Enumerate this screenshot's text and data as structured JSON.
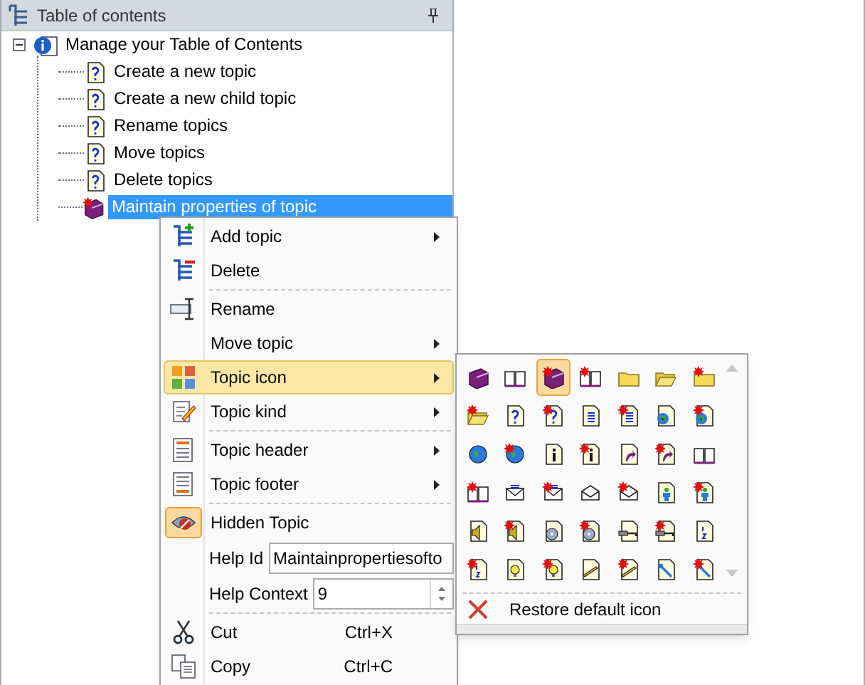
{
  "panel": {
    "title": "Table of contents"
  },
  "tree": [
    {
      "label": "Manage your Table of Contents",
      "kind": "info",
      "expanded": true,
      "selected": false,
      "children": [
        {
          "label": "Create a new topic",
          "kind": "question",
          "selected": false
        },
        {
          "label": "Create a new child topic",
          "kind": "question",
          "selected": false
        },
        {
          "label": "Rename topics",
          "kind": "question",
          "selected": false
        },
        {
          "label": "Move topics",
          "kind": "question",
          "selected": false
        },
        {
          "label": "Delete topics",
          "kind": "question",
          "selected": false
        },
        {
          "label": "Maintain properties of topic",
          "kind": "book",
          "selected": true
        }
      ]
    }
  ],
  "context_menu": [
    {
      "kind": "item",
      "label": "Add topic",
      "submenu": true,
      "selected": false,
      "checked": false,
      "separator_before": false
    },
    {
      "kind": "item",
      "label": "Delete",
      "submenu": false,
      "selected": false,
      "checked": false,
      "separator_before": false
    },
    {
      "kind": "item",
      "label": "Rename",
      "submenu": false,
      "selected": false,
      "checked": false,
      "separator_before": true
    },
    {
      "kind": "item",
      "label": "Move topic",
      "submenu": true,
      "selected": false,
      "checked": false,
      "separator_before": false
    },
    {
      "kind": "item",
      "label": "Topic icon",
      "submenu": true,
      "selected": true,
      "checked": false,
      "separator_before": false
    },
    {
      "kind": "item",
      "label": "Topic kind",
      "submenu": true,
      "selected": false,
      "checked": false,
      "separator_before": false
    },
    {
      "kind": "item",
      "label": "Topic header",
      "submenu": true,
      "selected": false,
      "checked": false,
      "separator_before": true
    },
    {
      "kind": "item",
      "label": "Topic footer",
      "submenu": true,
      "selected": false,
      "checked": false,
      "separator_before": false
    },
    {
      "kind": "item",
      "label": "Hidden Topic",
      "submenu": false,
      "selected": false,
      "checked": true,
      "separator_before": true
    },
    {
      "kind": "field",
      "label": "Help Id",
      "value": "Maintainpropertiesofto",
      "separator_before": false
    },
    {
      "kind": "spinner",
      "label": "Help Context",
      "value": "9",
      "separator_before": false
    },
    {
      "kind": "item",
      "label": "Cut",
      "shortcut": "Ctrl+X",
      "submenu": false,
      "selected": false,
      "checked": false,
      "separator_before": true
    },
    {
      "kind": "item",
      "label": "Copy",
      "shortcut": "Ctrl+C",
      "submenu": false,
      "selected": false,
      "checked": false,
      "separator_before": false
    }
  ],
  "icon_menu": {
    "icons": [
      {
        "kind": "book",
        "new": false,
        "selected": false
      },
      {
        "kind": "book-open",
        "new": false,
        "selected": false
      },
      {
        "kind": "book",
        "new": true,
        "selected": true
      },
      {
        "kind": "book-open",
        "new": true,
        "selected": false
      },
      {
        "kind": "folder",
        "new": false,
        "selected": false
      },
      {
        "kind": "folder-open",
        "new": false,
        "selected": false
      },
      {
        "kind": "folder",
        "new": true,
        "selected": false
      },
      {
        "kind": "folder-open",
        "new": true,
        "selected": false
      },
      {
        "kind": "page-question",
        "new": false,
        "selected": false
      },
      {
        "kind": "page-question",
        "new": true,
        "selected": false
      },
      {
        "kind": "page-lines",
        "new": false,
        "selected": false
      },
      {
        "kind": "page-lines",
        "new": true,
        "selected": false
      },
      {
        "kind": "page-globe",
        "new": false,
        "selected": false
      },
      {
        "kind": "page-globe",
        "new": true,
        "selected": false
      },
      {
        "kind": "globe",
        "new": false,
        "selected": false
      },
      {
        "kind": "globe",
        "new": true,
        "selected": false
      },
      {
        "kind": "page-info",
        "new": false,
        "selected": false
      },
      {
        "kind": "page-info",
        "new": true,
        "selected": false
      },
      {
        "kind": "page-arrow",
        "new": false,
        "selected": false
      },
      {
        "kind": "page-arrow",
        "new": true,
        "selected": false
      },
      {
        "kind": "book-open",
        "new": false,
        "selected": false
      },
      {
        "kind": "book-open",
        "new": true,
        "selected": false
      },
      {
        "kind": "envelope",
        "new": false,
        "selected": false
      },
      {
        "kind": "envelope",
        "new": true,
        "selected": false
      },
      {
        "kind": "envelope-open",
        "new": false,
        "selected": false
      },
      {
        "kind": "envelope-open",
        "new": true,
        "selected": false
      },
      {
        "kind": "page-person",
        "new": false,
        "selected": false
      },
      {
        "kind": "page-person",
        "new": true,
        "selected": false
      },
      {
        "kind": "page-speaker",
        "new": false,
        "selected": false
      },
      {
        "kind": "page-speaker",
        "new": true,
        "selected": false
      },
      {
        "kind": "page-disc",
        "new": false,
        "selected": false
      },
      {
        "kind": "page-disc",
        "new": true,
        "selected": false
      },
      {
        "kind": "page-key",
        "new": false,
        "selected": false
      },
      {
        "kind": "page-key",
        "new": true,
        "selected": false
      },
      {
        "kind": "page-numbers",
        "new": false,
        "selected": false
      },
      {
        "kind": "page-numbers",
        "new": true,
        "selected": false
      },
      {
        "kind": "page-bulb",
        "new": false,
        "selected": false
      },
      {
        "kind": "page-bulb",
        "new": true,
        "selected": false
      },
      {
        "kind": "page-pen",
        "new": false,
        "selected": false
      },
      {
        "kind": "page-pen",
        "new": true,
        "selected": false
      },
      {
        "kind": "page-wrench",
        "new": false,
        "selected": false
      },
      {
        "kind": "page-wrench",
        "new": true,
        "selected": false
      }
    ],
    "restore_label": "Restore default icon"
  }
}
